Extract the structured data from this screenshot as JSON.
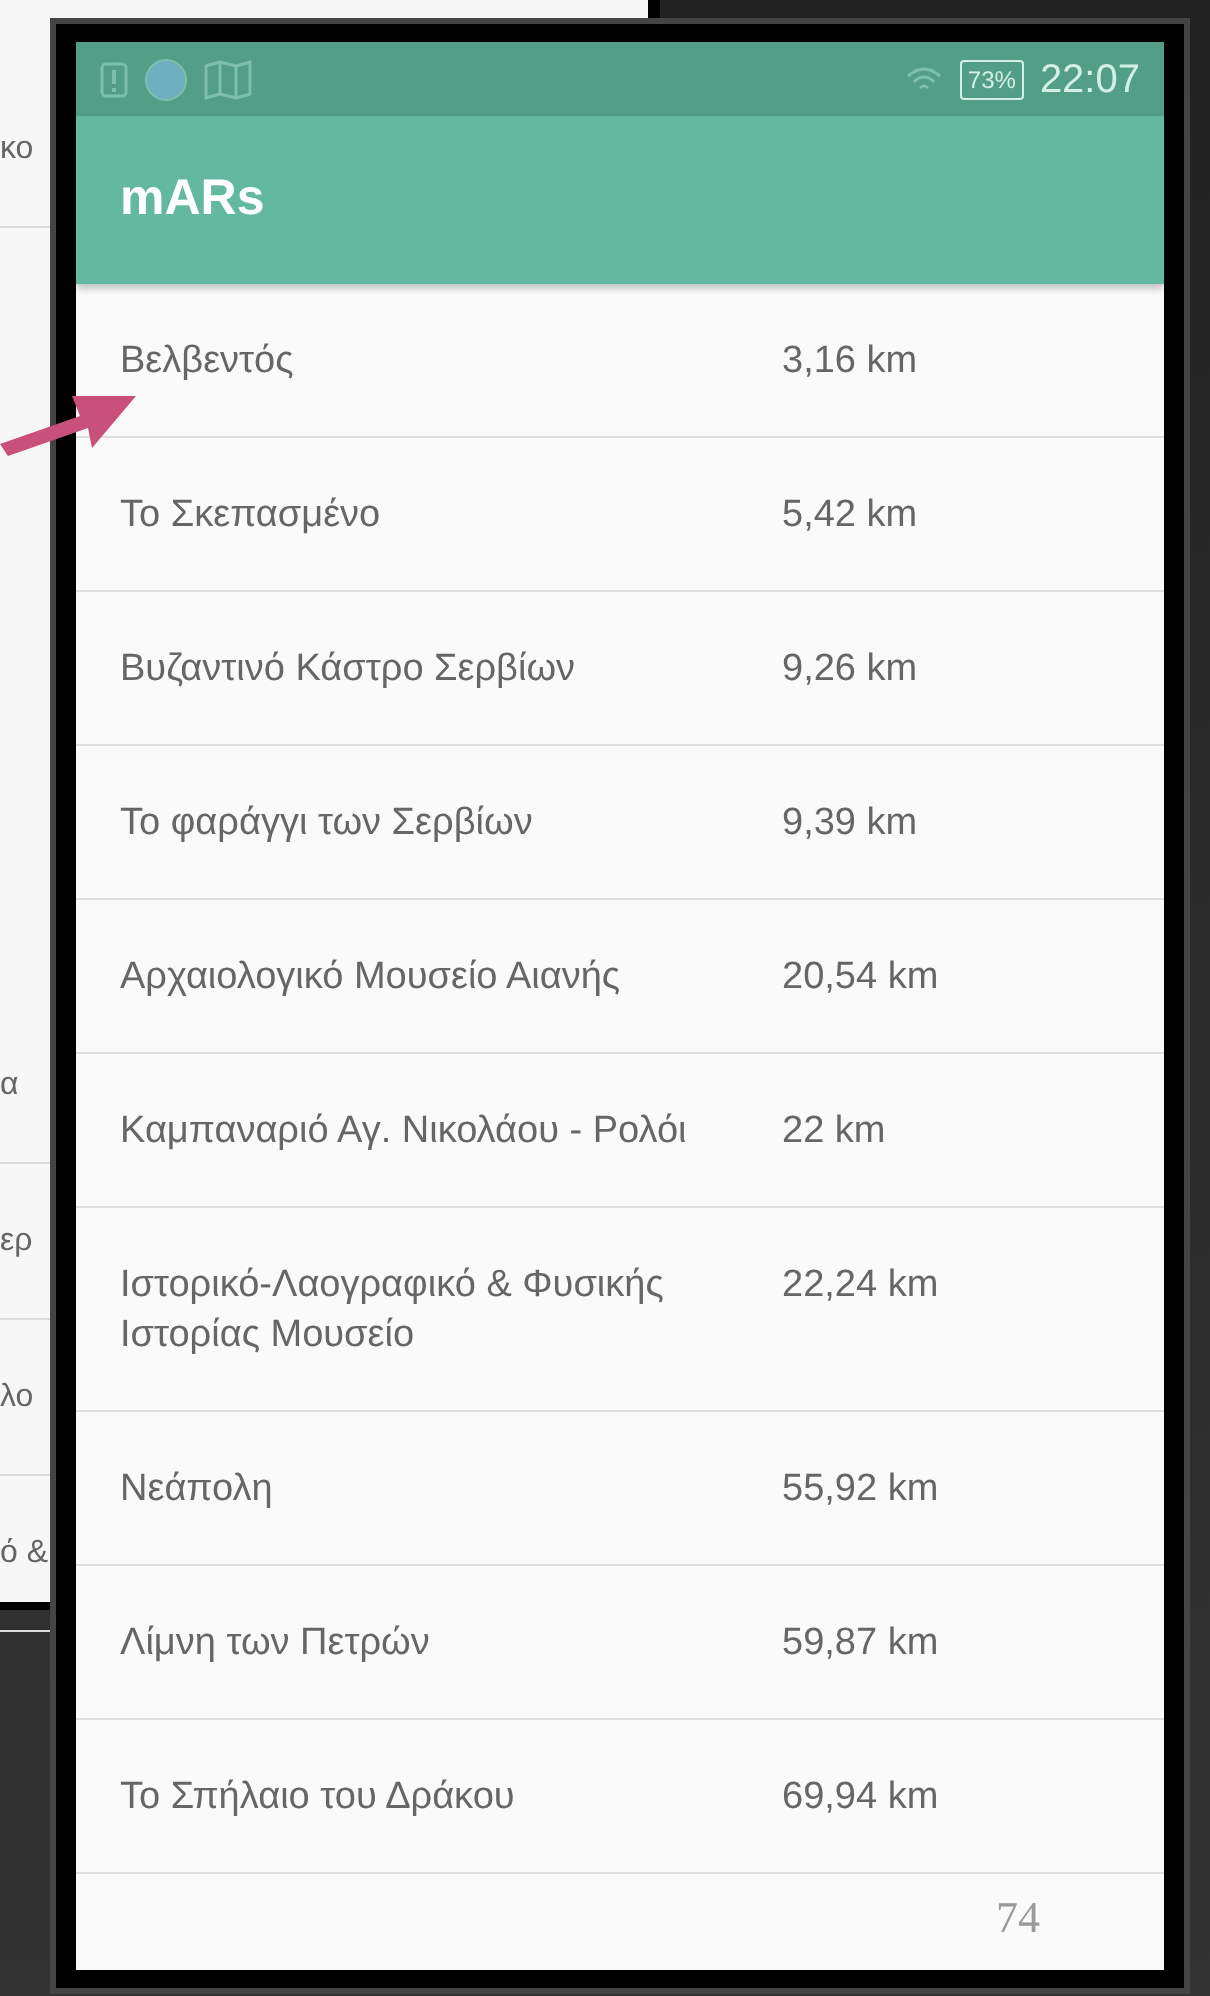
{
  "background_screen": {
    "row_fragments": [
      "κο",
      "α",
      "ερ",
      "λο",
      "ό &"
    ]
  },
  "status_bar": {
    "battery": "73%",
    "time": "22:07"
  },
  "app_bar": {
    "title": "mARs"
  },
  "places": [
    {
      "name": "Βελβεντός",
      "distance": "3,16 km"
    },
    {
      "name": "Το Σκεπασμένο",
      "distance": "5,42 km"
    },
    {
      "name": "Βυζαντινό Κάστρο Σερβίων",
      "distance": "9,26 km"
    },
    {
      "name": "Το φαράγγι των Σερβίων",
      "distance": "9,39 km"
    },
    {
      "name": "Αρχαιολογικό Μουσείο Αιανής",
      "distance": "20,54 km"
    },
    {
      "name": "Καμπαναριό Αγ. Νικολάου - Ρολόι",
      "distance": "22 km"
    },
    {
      "name": "Ιστορικό-Λαογραφικό & Φυσικής Ιστορίας Μουσείο",
      "distance": "22,24 km"
    },
    {
      "name": "Νεάπολη",
      "distance": "55,92 km"
    },
    {
      "name": "Λίμνη των Πετρών",
      "distance": "59,87 km"
    },
    {
      "name": "Το Σπήλαιο του Δράκου",
      "distance": "69,94 km"
    }
  ],
  "page_number": "74"
}
